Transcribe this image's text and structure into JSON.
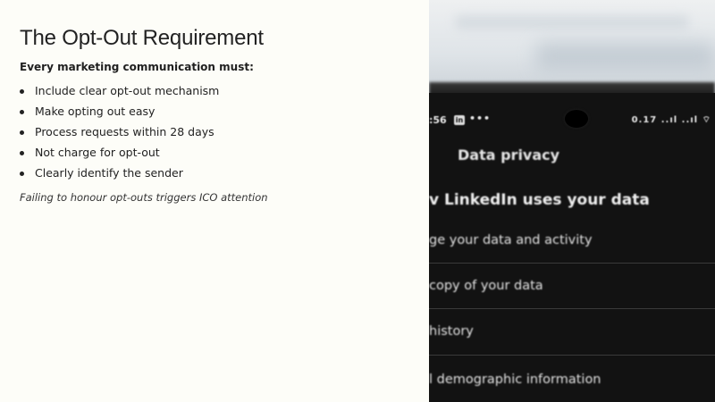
{
  "slide": {
    "title": "The Opt-Out Requirement",
    "subheading": "Every marketing communication must:",
    "bullets": [
      "Include clear opt-out mechanism",
      "Make opting out easy",
      "Process requests within 28 days",
      "Not charge for opt-out",
      "Clearly identify the sender"
    ],
    "note": "Failing to honour opt-outs triggers ICO attention"
  },
  "photo": {
    "status_time": ":56",
    "status_app": "in",
    "status_more": "•••",
    "status_right": "0.17 ..ıl ..ıl ⌔",
    "screen_title": "Data privacy",
    "section_heading": "v LinkedIn uses your data",
    "rows": [
      "ge your data and activity",
      "copy of your data",
      "history",
      "l demographic information"
    ]
  }
}
